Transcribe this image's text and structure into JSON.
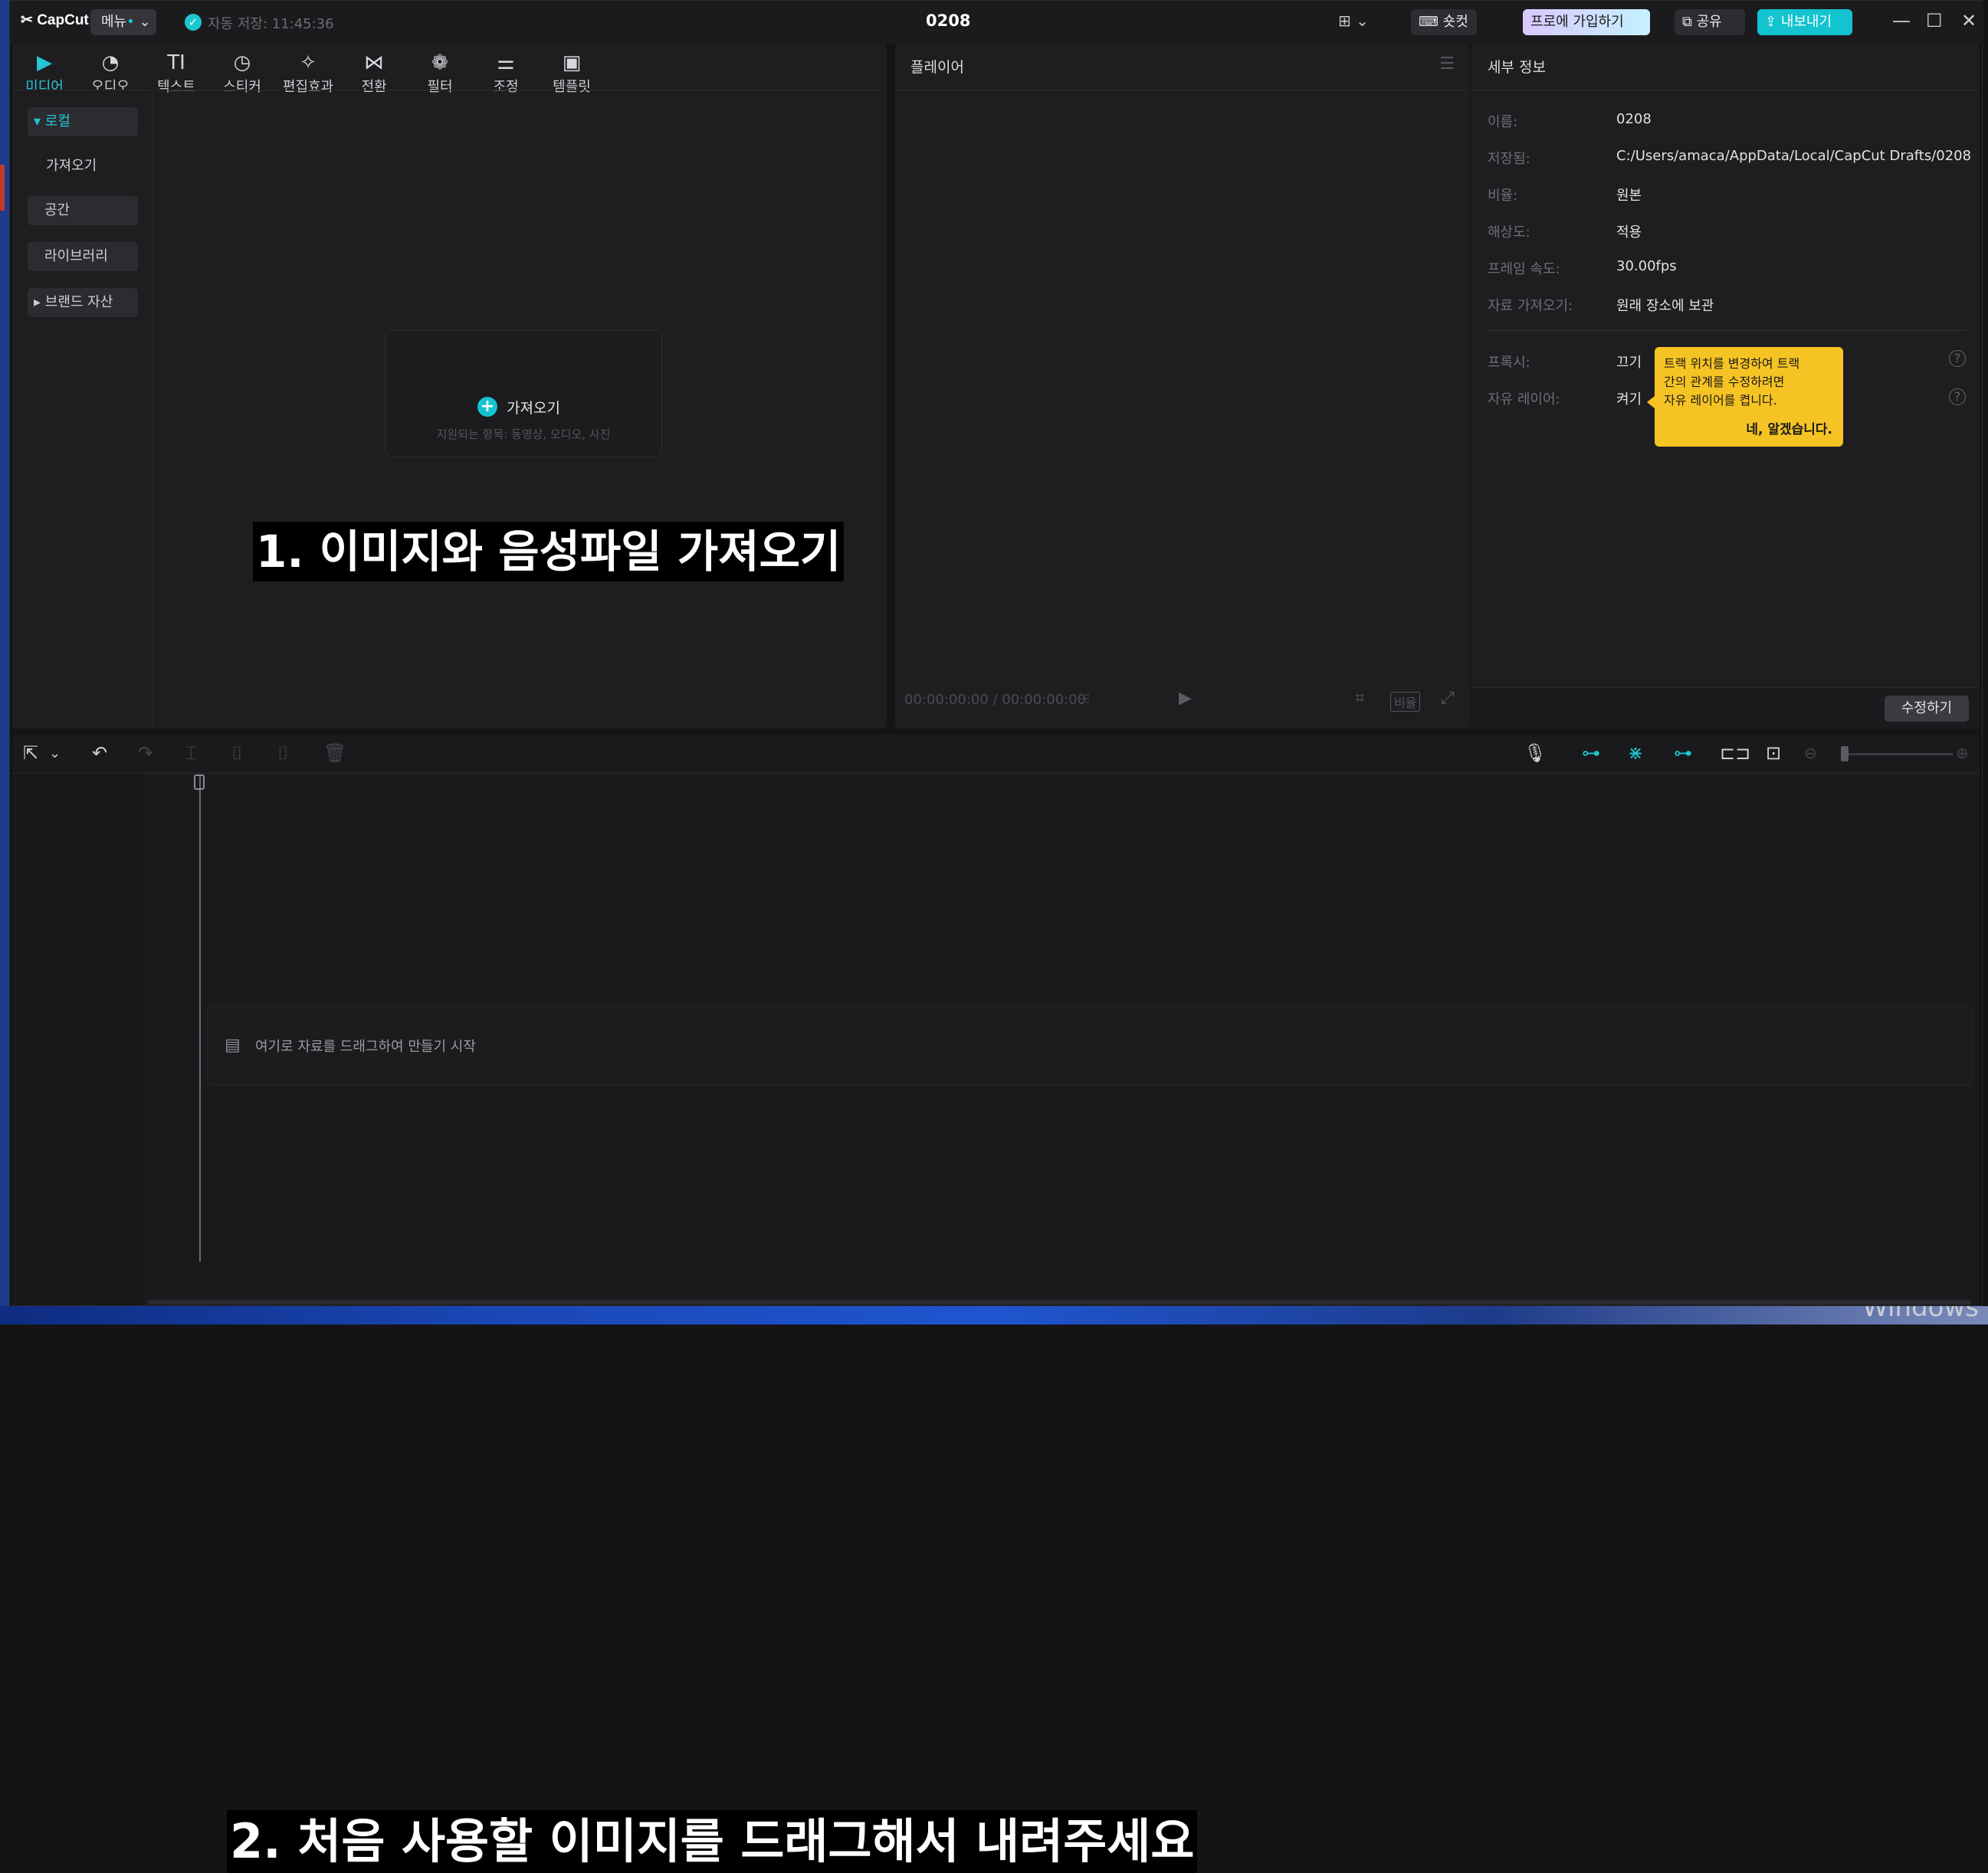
{
  "app": {
    "logo": "CapCut",
    "menu_label": "메뉴",
    "menu_dot": "•",
    "autosave": "자동 저장: 11:45:36",
    "title": "0208",
    "shortcut_label": "숏컷",
    "pro_label": "프로에 가입하기",
    "share_label": "공유",
    "export_label": "내보내기"
  },
  "media": {
    "tools": [
      {
        "label": "미디어",
        "icon": "▶"
      },
      {
        "label": "오디오",
        "icon": "◔"
      },
      {
        "label": "텍스트",
        "icon": "TI"
      },
      {
        "label": "스티커",
        "icon": "◷"
      },
      {
        "label": "편집효과",
        "icon": "✧"
      },
      {
        "label": "전환",
        "icon": "⋈"
      },
      {
        "label": "필터",
        "icon": "❁"
      },
      {
        "label": "조정",
        "icon": "⚌"
      },
      {
        "label": "템플릿",
        "icon": "▣"
      }
    ],
    "sidebar": {
      "local": "로컬",
      "import": "가져오기",
      "space": "공간",
      "library": "라이브러리",
      "brand": "브랜드 자산"
    },
    "import_button": "가져오기",
    "import_sub": "지원되는 항목: 동영상, 오디오, 사진"
  },
  "captions": {
    "step1": "1. 이미지와 음성파일 가져오기",
    "step2": "2. 처음 사용할 이미지를 드래그해서 내려주세요"
  },
  "player": {
    "title": "플레이어",
    "time": "00:00:00:00 / 00:00:00:00",
    "ratio": "비율"
  },
  "detail": {
    "title": "세부 정보",
    "rows": [
      {
        "label": "이름:",
        "value": "0208"
      },
      {
        "label": "저장됨:",
        "value": "C:/Users/amaca/AppData/Local/CapCut Drafts/0208"
      },
      {
        "label": "비율:",
        "value": "원본"
      },
      {
        "label": "해상도:",
        "value": "적용"
      },
      {
        "label": "프레임 속도:",
        "value": "30.00fps"
      },
      {
        "label": "자료 가져오기:",
        "value": "원래 장소에 보관"
      }
    ],
    "proxy_label": "프록시:",
    "proxy_value": "끄기",
    "free_layer_label": "자유 레이어:",
    "free_layer_value": "켜기",
    "tooltip_line1": "트랙 위치를 변경하여 트랙",
    "tooltip_line2": "간의 관계를 수정하려면",
    "tooltip_line3": "자유 레이어를 켭니다.",
    "tooltip_ok": "네, 알겠습니다.",
    "modify_button": "수정하기"
  },
  "timeline": {
    "drop_hint": "여기로 자료를 드래그하여 만들기 시작"
  },
  "os": {
    "watermark": "Windows"
  },
  "colors": {
    "accent": "#1cc7d0",
    "tooltip": "#f5c323",
    "background": "#1e1e21"
  }
}
